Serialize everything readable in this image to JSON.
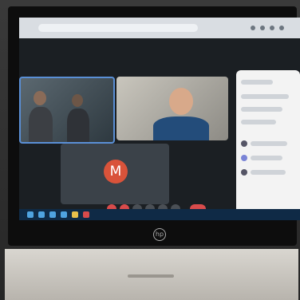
{
  "scene": {
    "laptop_brand": "hp",
    "video_call": {
      "participant_avatar_letter": "M",
      "tiles": [
        "participant-group",
        "participant-speaker",
        "participant-avatar"
      ],
      "panel": "people-panel"
    }
  },
  "colors": {
    "avatar_bg": "#d9533a",
    "active_tile_border": "#5a8fd6",
    "control_button": "#d84b4b",
    "taskbar": "#0f2a46"
  }
}
